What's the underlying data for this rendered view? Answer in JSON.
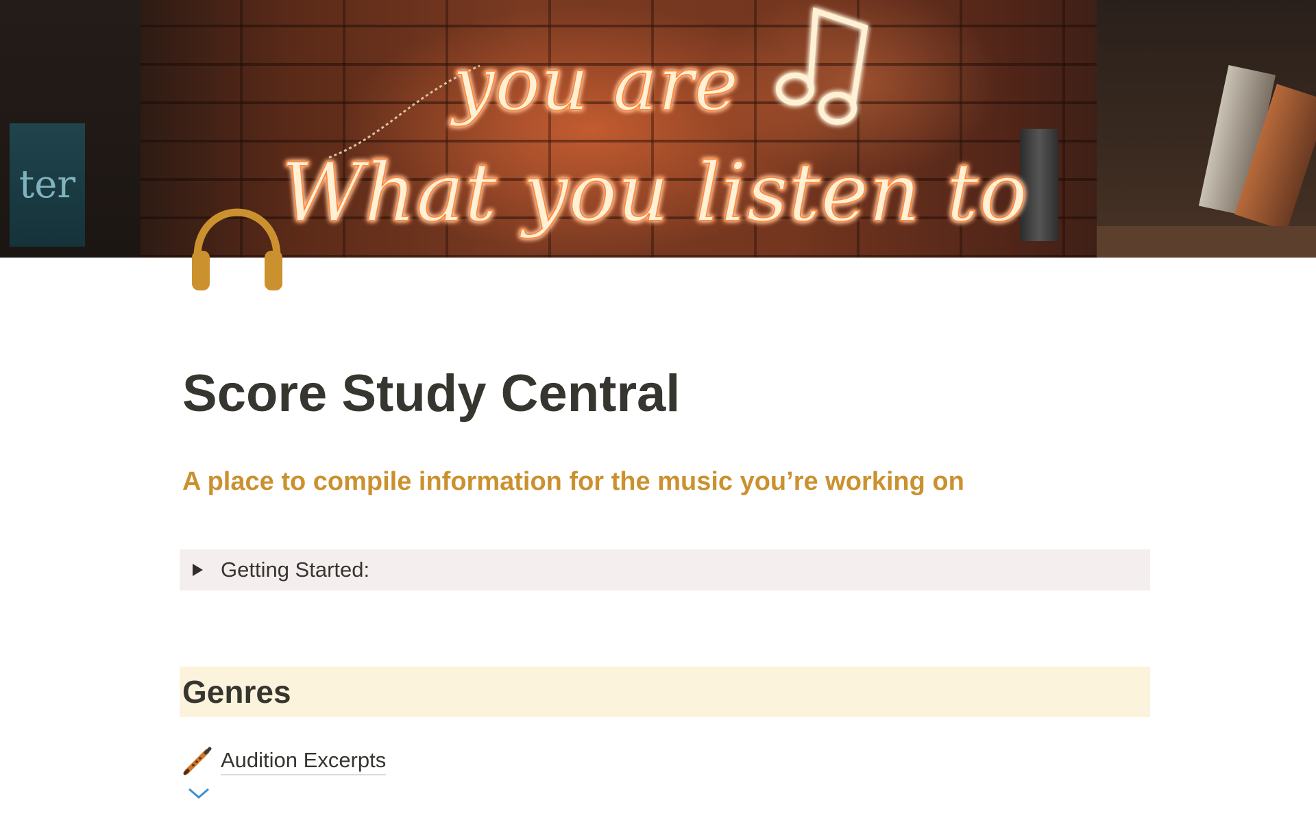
{
  "cover": {
    "neon_line1": "you are",
    "neon_line2": "What you listen to",
    "shelf_book_text": "ter"
  },
  "page": {
    "icon": "headphones-icon",
    "icon_color": "#cb912f",
    "title": "Score Study Central",
    "subtitle": "A place to compile information for the music you’re working on",
    "subtitle_color": "#cb912f"
  },
  "toggle": {
    "label": "Getting Started:",
    "expanded": false,
    "icon": "triangle-right-icon",
    "background": "#f4eeee"
  },
  "genres": {
    "heading": "Genres",
    "background": "#fbf3db",
    "links": [
      {
        "label": "Audition Excerpts",
        "icon": "flute-icon"
      },
      {
        "label": "",
        "icon": "page-icon"
      }
    ]
  }
}
